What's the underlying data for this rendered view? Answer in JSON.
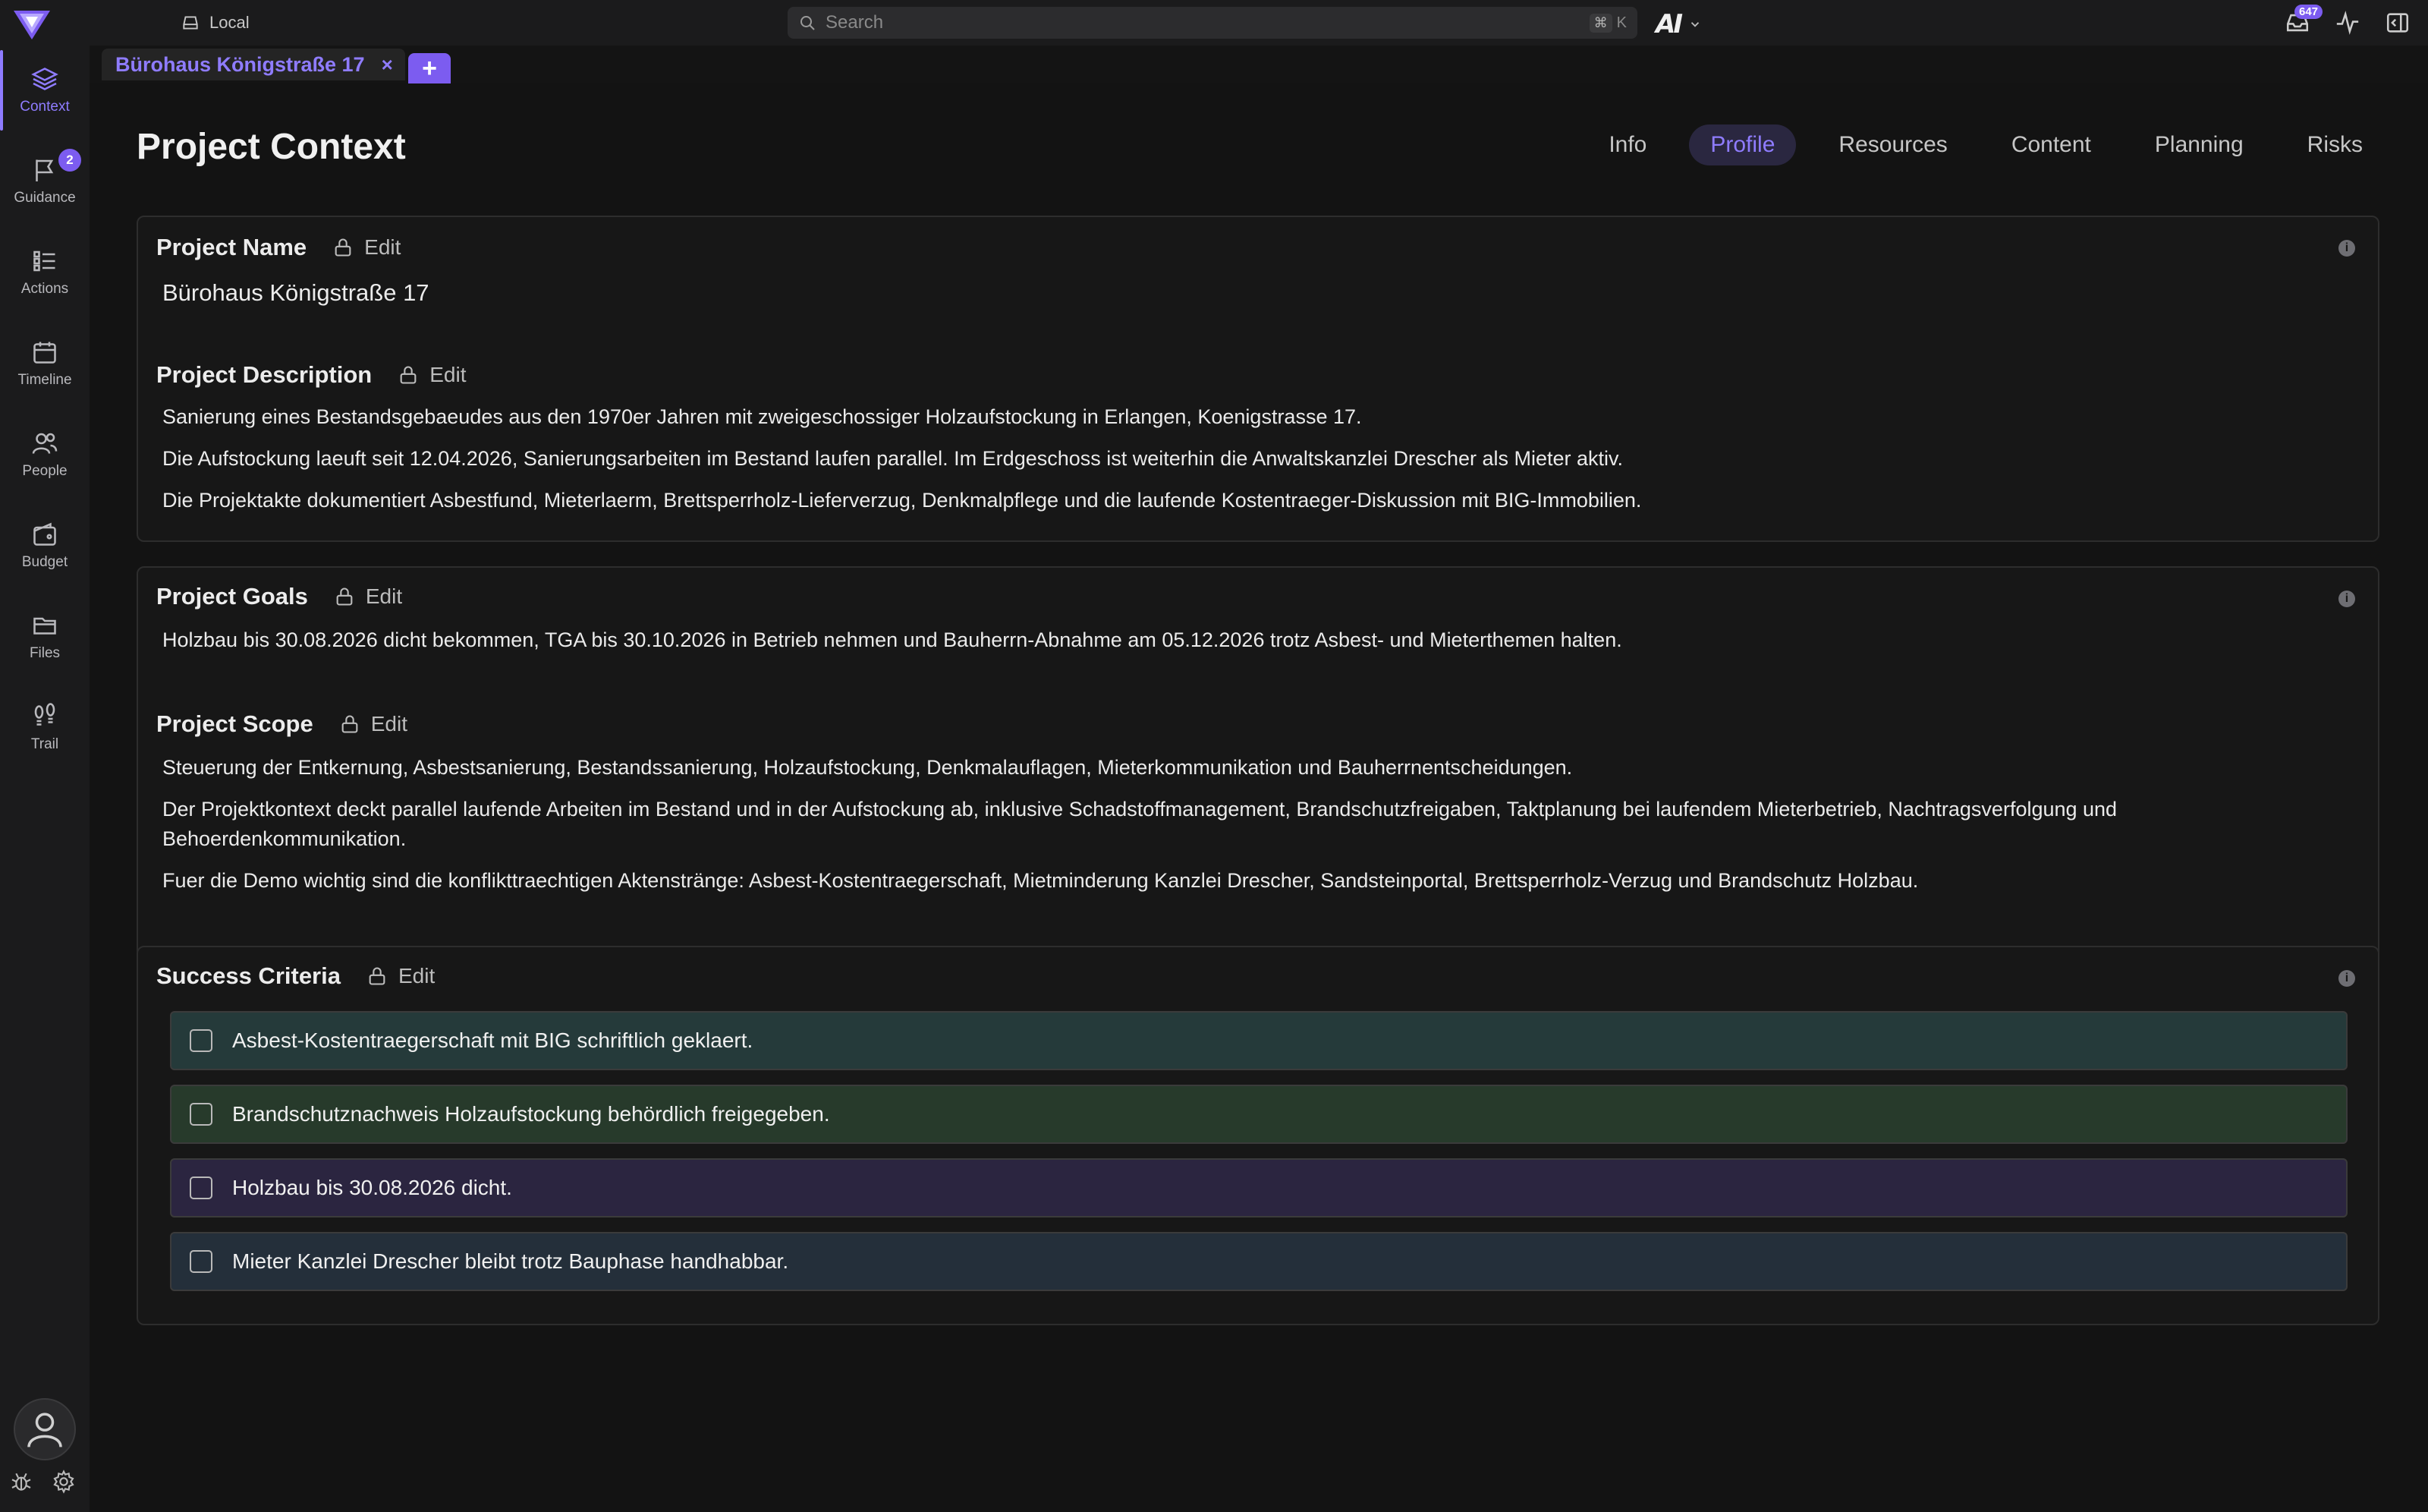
{
  "topbar": {
    "workspace": "Local",
    "search_placeholder": "Search",
    "shortcut_symbol": "⌘",
    "shortcut_key": "K",
    "brand": "AI",
    "inbox_count": "647"
  },
  "sidebar": {
    "items": [
      {
        "label": "Context",
        "icon": "layers-icon",
        "active": true
      },
      {
        "label": "Guidance",
        "icon": "flag-icon",
        "badge": "2"
      },
      {
        "label": "Actions",
        "icon": "checklist-icon"
      },
      {
        "label": "Timeline",
        "icon": "calendar-icon"
      },
      {
        "label": "People",
        "icon": "people-icon"
      },
      {
        "label": "Budget",
        "icon": "wallet-icon"
      },
      {
        "label": "Files",
        "icon": "folder-icon"
      },
      {
        "label": "Trail",
        "icon": "footprints-icon"
      }
    ]
  },
  "doc_tab": {
    "title": "Bürohaus Königstraße 17",
    "close": "×",
    "add": "+"
  },
  "page": {
    "title": "Project Context",
    "tabs": [
      "Info",
      "Profile",
      "Resources",
      "Content",
      "Planning",
      "Risks"
    ],
    "active_tab": "Profile"
  },
  "sections": {
    "edit_label": "Edit",
    "name": {
      "title": "Project Name",
      "value": "Bürohaus Königstraße 17"
    },
    "description": {
      "title": "Project Description",
      "paragraphs": [
        "Sanierung eines Bestandsgebaeudes aus den 1970er Jahren mit zweigeschossiger Holzaufstockung in Erlangen, Koenigstrasse 17.",
        "Die Aufstockung laeuft seit 12.04.2026, Sanierungsarbeiten im Bestand laufen parallel. Im Erdgeschoss ist weiterhin die Anwaltskanzlei Drescher als Mieter aktiv.",
        "Die Projektakte dokumentiert Asbestfund, Mieterlaerm, Brettsperrholz-Lieferverzug, Denkmalpflege und die laufende Kostentraeger-Diskussion mit BIG-Immobilien."
      ]
    },
    "goals": {
      "title": "Project Goals",
      "paragraphs": [
        "Holzbau bis 30.08.2026 dicht bekommen, TGA bis 30.10.2026 in Betrieb nehmen und Bauherrn-Abnahme am 05.12.2026 trotz Asbest- und Mieterthemen halten."
      ]
    },
    "scope": {
      "title": "Project Scope",
      "paragraphs": [
        "Steuerung der Entkernung, Asbestsanierung, Bestandssanierung, Holzaufstockung, Denkmalauflagen, Mieterkommunikation und Bauherrnentscheidungen.",
        "Der Projektkontext deckt parallel laufende Arbeiten im Bestand und in der Aufstockung ab, inklusive Schadstoffmanagement, Brandschutzfreigaben, Taktplanung bei laufendem Mieterbetrieb, Nachtragsverfolgung und Behoerdenkommunikation.",
        "Fuer die Demo wichtig sind die konflikttraechtigen Aktenstränge: Asbest-Kostentraegerschaft, Mietminderung Kanzlei Drescher, Sandsteinportal, Brettsperrholz-Verzug und Brandschutz Holzbau."
      ]
    },
    "criteria": {
      "title": "Success Criteria",
      "items": [
        {
          "text": "Asbest-Kostentraegerschaft mit BIG schriftlich geklaert.",
          "color": "#253a3a"
        },
        {
          "text": "Brandschutznachweis Holzaufstockung behördlich freigegeben.",
          "color": "#273a2b"
        },
        {
          "text": "Holzbau bis 30.08.2026 dicht.",
          "color": "#2b2540"
        },
        {
          "text": "Mieter Kanzlei Drescher bleibt trotz Bauphase handhabbar.",
          "color": "#242f3a"
        }
      ]
    }
  },
  "colors": {
    "accent": "#8f7cff",
    "accent_strong": "#7c5cf0",
    "background": "#131313",
    "card": "#171717"
  }
}
